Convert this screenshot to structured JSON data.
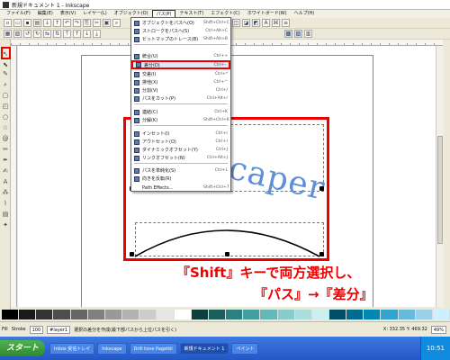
{
  "window": {
    "title": "新規ドキュメント 1 - Inkscape"
  },
  "menubar": [
    {
      "label": "ファイル(F)",
      "active": false
    },
    {
      "label": "編集(E)",
      "active": false
    },
    {
      "label": "表示(V)",
      "active": false
    },
    {
      "label": "レイヤー(L)",
      "active": false
    },
    {
      "label": "オブジェクト(O)",
      "active": false
    },
    {
      "label": "パス(P)",
      "active": true
    },
    {
      "label": "テキスト(T)",
      "active": false
    },
    {
      "label": "エフェクト(C)",
      "active": false
    },
    {
      "label": "ホワイトボード(W)",
      "active": false
    },
    {
      "label": "ヘルプ(H)",
      "active": false
    }
  ],
  "path_menu": {
    "items": [
      {
        "label": "オブジェクトをパスへ(O)",
        "shortcut": "Shift+Ctrl+C",
        "highlighted": false
      },
      {
        "label": "ストロークをパスへ(S)",
        "shortcut": "Ctrl+Alt+C",
        "highlighted": false
      },
      {
        "label": "ビットマップのトレース(B)",
        "shortcut": "Shift+Alt+B",
        "highlighted": false
      },
      {
        "label": "統合(U)",
        "shortcut": "Ctrl++",
        "highlighted": false
      },
      {
        "label": "差分(D)",
        "shortcut": "Ctrl+-",
        "highlighted": true
      },
      {
        "label": "交差(I)",
        "shortcut": "Ctrl+*",
        "highlighted": false
      },
      {
        "label": "排他(X)",
        "shortcut": "Ctrl+^",
        "highlighted": false
      },
      {
        "label": "分割(V)",
        "shortcut": "Ctrl+/",
        "highlighted": false
      },
      {
        "label": "パスをカット(P)",
        "shortcut": "Ctrl+Alt+/",
        "highlighted": false
      },
      {
        "label": "連結(C)",
        "shortcut": "Ctrl+K",
        "highlighted": false
      },
      {
        "label": "分解(K)",
        "shortcut": "Shift+Ctrl+K",
        "highlighted": false
      },
      {
        "label": "インセット(I)",
        "shortcut": "Ctrl+(",
        "highlighted": false
      },
      {
        "label": "アウトセット(O)",
        "shortcut": "Ctrl+)",
        "highlighted": false
      },
      {
        "label": "ダイナミックオフセット(Y)",
        "shortcut": "Ctrl+J",
        "highlighted": false
      },
      {
        "label": "リンクオフセット(N)",
        "shortcut": "Ctrl+Alt+J",
        "highlighted": false
      },
      {
        "label": "パスを単純化(S)",
        "shortcut": "Ctrl+L",
        "highlighted": false
      },
      {
        "label": "向きを反転(R)",
        "shortcut": "",
        "highlighted": false
      },
      {
        "label": "Path Effects...",
        "shortcut": "Shift+Ctrl+7",
        "highlighted": false
      }
    ]
  },
  "canvas": {
    "text": "Inkscaper"
  },
  "annotations": {
    "line1": "『Shift』キーで両方選択し、",
    "line2": "『パス』→『差分』"
  },
  "palette": [
    "#000000",
    "#1a1a1a",
    "#333333",
    "#4d4d4d",
    "#666666",
    "#808080",
    "#999999",
    "#b3b3b3",
    "#cccccc",
    "#e6e6e6",
    "#ffffff",
    "#0d3d3d",
    "#1a5e5e",
    "#2e8080",
    "#44a0a0",
    "#66b8b8",
    "#88cccc",
    "#aadddd",
    "#cceeee",
    "#004d66",
    "#006b8f",
    "#0088b3",
    "#33a3cc",
    "#66bbdd",
    "#99d0e8",
    "#ccf0ff"
  ],
  "statusbar": {
    "fill_label": "Fill",
    "stroke_label": "Stroke",
    "opacity": "100",
    "layer": "#layer1",
    "message": "選択の差分を作成(最下部パスから上位パスを引く)",
    "coords": "X: 332.35  Y: 469.32",
    "zoom": "49%"
  },
  "taskbar": {
    "start": "スタート",
    "tasks": [
      "Inbox 受信トレイ",
      "Inkscape",
      "Drill tone Pagetbl",
      "新規ドキュメント 1",
      "ペイント"
    ],
    "clock": "10:51"
  },
  "colors": {
    "accent_red": "#e00000",
    "text_blue": "#5e8fd8",
    "taskbar": "#2357c7"
  }
}
